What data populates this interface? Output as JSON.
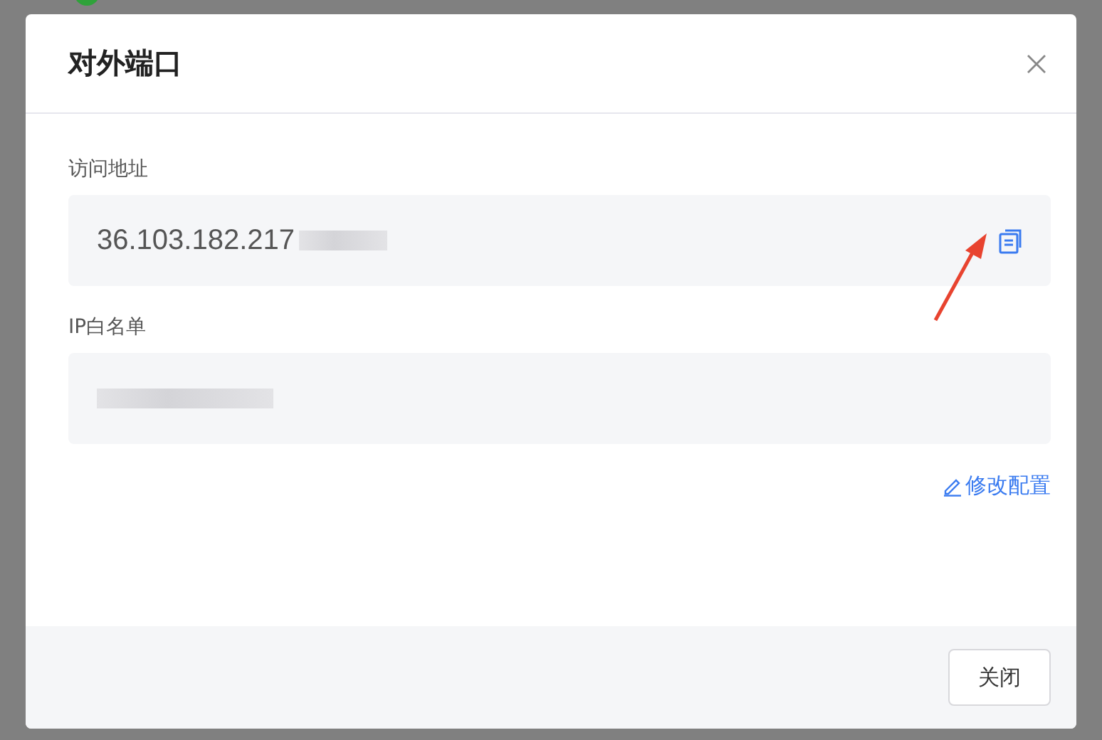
{
  "dialog": {
    "title": "对外端口"
  },
  "fields": [
    {
      "label": "访问地址",
      "kind": "address",
      "value": "36.103.182.217"
    },
    {
      "label": "IP白名单",
      "kind": "list"
    }
  ],
  "edit_link": "修改配置",
  "buttons": [
    "关闭"
  ]
}
